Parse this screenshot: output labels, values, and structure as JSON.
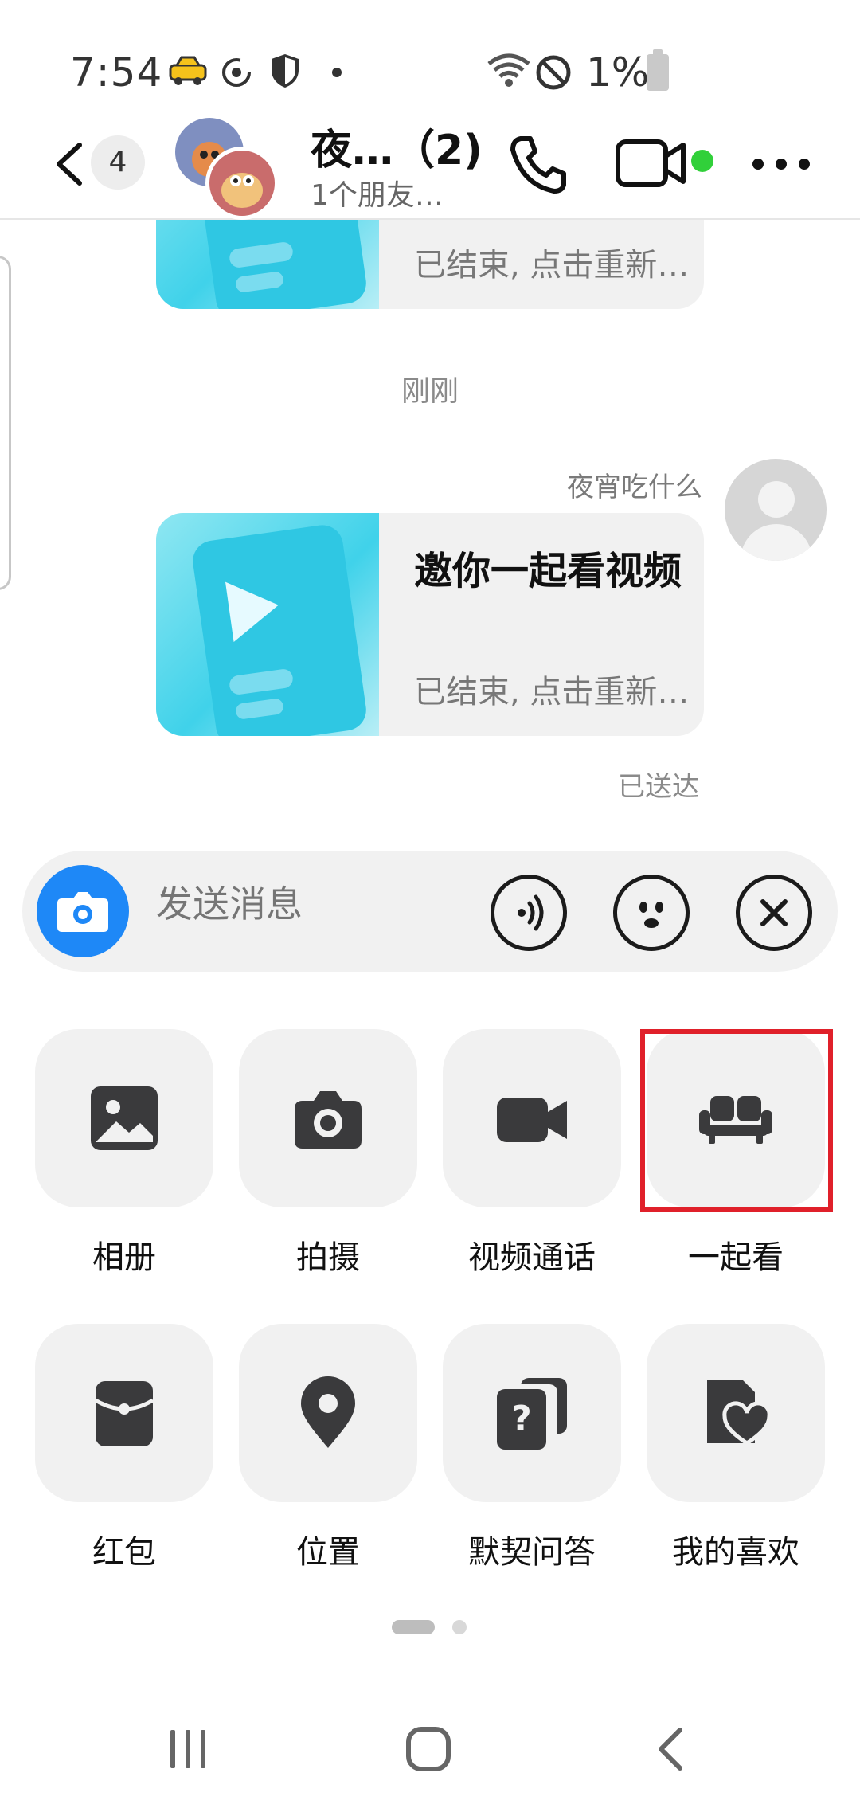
{
  "status_bar": {
    "time": "7:54",
    "battery": "1%"
  },
  "header": {
    "unread_count": "4",
    "title": "夜…（2)",
    "subtitle": "1个朋友…"
  },
  "chat": {
    "top_card_sub": "已结束, 点击重新…",
    "timestamp": "刚刚",
    "sender_name": "夜宵吃什么",
    "card_title": "邀你一起看视频",
    "card_sub": "已结束, 点击重新…",
    "delivery_status": "已送达"
  },
  "composer": {
    "placeholder": "发送消息"
  },
  "grid": {
    "items": [
      {
        "label": "相册",
        "icon": "photo-album-icon"
      },
      {
        "label": "拍摄",
        "icon": "camera-icon"
      },
      {
        "label": "视频通话",
        "icon": "video-call-icon"
      },
      {
        "label": "一起看",
        "icon": "sofa-icon"
      },
      {
        "label": "红包",
        "icon": "red-envelope-icon"
      },
      {
        "label": "位置",
        "icon": "location-icon"
      },
      {
        "label": "默契问答",
        "icon": "question-cards-icon"
      },
      {
        "label": "我的喜欢",
        "icon": "favorite-file-icon"
      }
    ]
  },
  "accent_colors": {
    "online": "#31d03a",
    "camera_button": "#1e88f7",
    "highlight_box": "#e0202a"
  }
}
